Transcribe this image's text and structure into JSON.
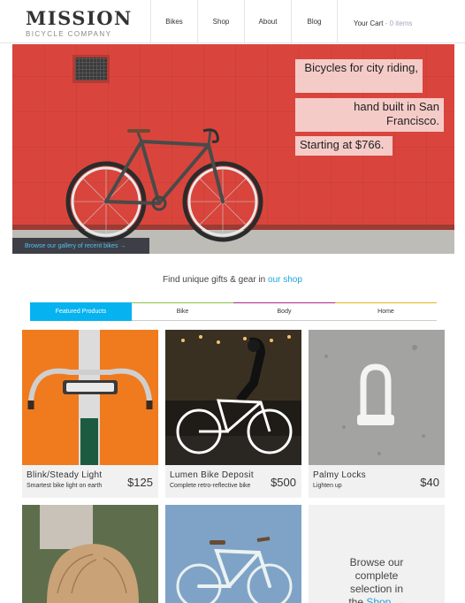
{
  "header": {
    "logo_title": "MISSION",
    "logo_subtitle": "BICYCLE COMPANY",
    "nav": [
      "Bikes",
      "Shop",
      "About",
      "Blog"
    ],
    "cart_label": "Your Cart",
    "cart_separator": " - ",
    "cart_count": "0 items"
  },
  "hero": {
    "tagline_1": "Bicycles for city riding,",
    "tagline_2": "hand built in San Francisco.",
    "tagline_3": "Starting at $766.",
    "gallery_link": "Browse our gallery of recent bikes →"
  },
  "shop_line": {
    "text": "Find unique gifts & gear in ",
    "link": "our shop"
  },
  "tabs": [
    {
      "label": "Featured Products",
      "color": "#06b2f0"
    },
    {
      "label": "Bike",
      "color": "#8bc34a"
    },
    {
      "label": "Body",
      "color": "#b0268f"
    },
    {
      "label": "Home",
      "color": "#e3b21f"
    }
  ],
  "products": [
    {
      "name": "Blink/Steady Light",
      "desc": "Smartest bike light on earth",
      "price": "$125"
    },
    {
      "name": "Lumen Bike Deposit",
      "desc": "Complete retro-reflective bike",
      "price": "$500"
    },
    {
      "name": "Palmy Locks",
      "desc": "Lighten up",
      "price": "$40"
    }
  ],
  "browse": {
    "text_1": "Browse our",
    "text_2": "complete",
    "text_3": "selection in",
    "text_4": "the ",
    "link": "Shop →"
  },
  "colors": {
    "accent": "#06b2f0",
    "hero_wall": "#d9453c"
  }
}
